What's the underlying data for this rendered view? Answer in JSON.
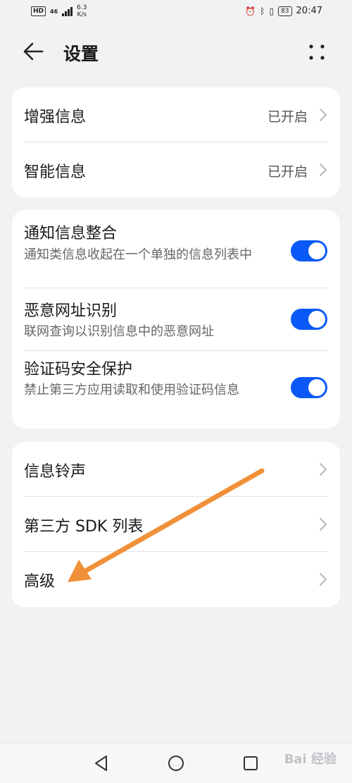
{
  "status_bar": {
    "hd": "HD",
    "network": "46",
    "speed_value": "6.3",
    "speed_unit": "K/s",
    "battery": "83",
    "time": "20:47",
    "icons": [
      "alarm-icon",
      "bluetooth-icon",
      "vibrate-icon",
      "battery-icon"
    ]
  },
  "header": {
    "title": "设置",
    "icons": [
      "back-arrow-icon",
      "more-icon"
    ]
  },
  "group1": {
    "items": [
      {
        "label": "增强信息",
        "value": "已开启"
      },
      {
        "label": "智能信息",
        "value": "已开启"
      }
    ]
  },
  "group2": {
    "items": [
      {
        "label": "通知信息整合",
        "desc": "通知类信息收起在一个单独的信息列表中",
        "enabled": true
      },
      {
        "label": "恶意网址识别",
        "desc": "联网查询以识别信息中的恶意网址",
        "enabled": true
      },
      {
        "label": "验证码安全保护",
        "desc": "禁止第三方应用读取和使用验证码信息",
        "enabled": true
      }
    ]
  },
  "group3": {
    "items": [
      {
        "label": "信息铃声"
      },
      {
        "label": "第三方 SDK 列表"
      },
      {
        "label": "高级"
      }
    ]
  },
  "navbar": {
    "icons": [
      "nav-back-icon",
      "nav-home-icon",
      "nav-recents-icon"
    ],
    "watermark": "Bai 经验"
  },
  "colors": {
    "accent": "#0a59f7",
    "arrow": "#f0913a",
    "background": "#f1f2f4"
  }
}
